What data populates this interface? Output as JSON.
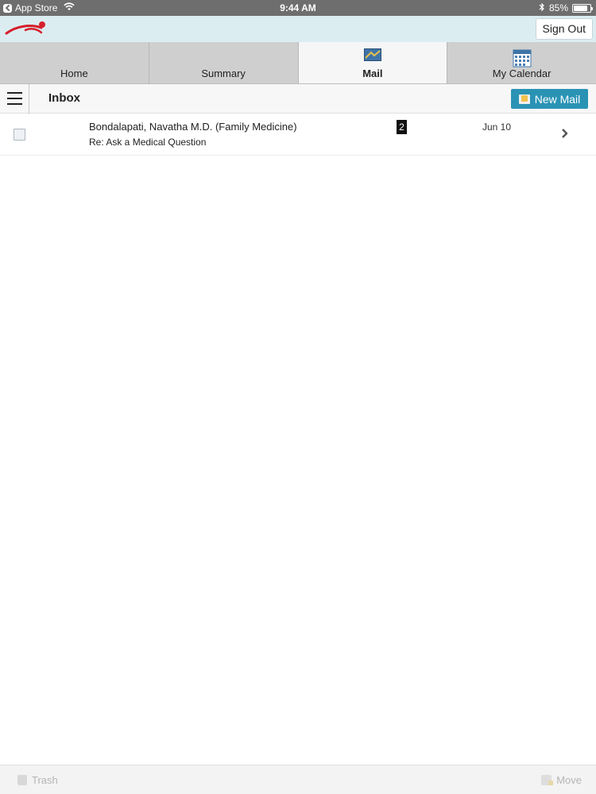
{
  "status_bar": {
    "back_app": "App Store",
    "time": "9:44 AM",
    "battery_text": "85%",
    "battery_level": 0.85
  },
  "header": {
    "sign_out_label": "Sign Out"
  },
  "tabs": [
    {
      "label": "Home",
      "active": false
    },
    {
      "label": "Summary",
      "active": false
    },
    {
      "label": "Mail",
      "active": true
    },
    {
      "label": "My Calendar",
      "active": false
    }
  ],
  "toolbar": {
    "title": "Inbox",
    "new_mail_label": "New Mail",
    "accent_color": "#2a93b4"
  },
  "messages": [
    {
      "sender": "Bondalapati, Navatha M.D. (Family Medicine)",
      "subject": "Re: Ask a Medical Question",
      "count": "2",
      "date": "Jun 10"
    }
  ],
  "bottom_bar": {
    "trash_label": "Trash",
    "move_label": "Move"
  },
  "icons": [
    "logo-icon",
    "wifi-icon",
    "bluetooth-icon",
    "battery-icon",
    "mail-tab-icon",
    "calendar-tab-icon",
    "hamburger-menu-icon",
    "new-mail-icon",
    "chevron-right-icon",
    "trash-icon",
    "move-icon"
  ]
}
